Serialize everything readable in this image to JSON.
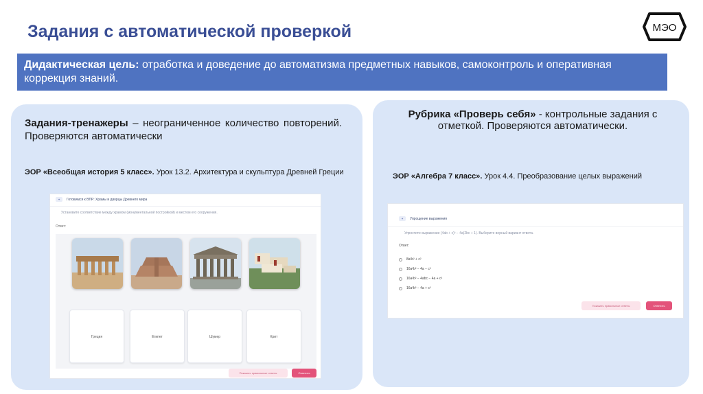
{
  "title": "Задания с автоматической проверкой",
  "logo_text": "МЭО",
  "goal": {
    "label": "Дидактическая цель:",
    "text": " отработка и доведение до автоматизма предметных навыков, самоконтроль и оперативная коррекция знаний."
  },
  "left": {
    "desc_bold": "Задания-тренажеры",
    "desc_text": " – неограниченное количество повторений. Проверяются автоматически",
    "eor_bold": "ЭОР «Всеобщая история 5 класс».",
    "eor_text": " Урок 13.2. Архитектура и скульптура Древней Греции",
    "screenshot": {
      "header": "Готовимся к ВПР: Храмы и дворцы Древнего мира",
      "instruction": "Установите соответствие между храмом (монументальной постройкой) и местом его сооружения.",
      "answer_label": "Ответ:",
      "cards": [
        "Греция",
        "Египет",
        "Шумер",
        "Крит"
      ],
      "show_answers_button": "Показать правильные ответы",
      "submit_button": "Ответить"
    }
  },
  "right": {
    "desc_bold": "Рубрика «Проверь себя»",
    "desc_text": " - контрольные задания с отметкой. Проверяются автоматически.",
    "eor_bold": "ЭОР «Алгебра 7 класс».",
    "eor_text": " Урок 4.4. Преобразование целых выражений",
    "screenshot": {
      "header": "Упрощение выражения",
      "task": "Упростите выражение (4ab + c)² − 4a(2bc + 1). Выберите верный вариант ответа.",
      "answer_label": "Ответ:",
      "options": [
        "8a²b² + c²",
        "16a²b² − 4a − c²",
        "16a²b² − 4abc − 4a + c²",
        "16a²b² − 4a + c²"
      ],
      "show_answers_button": "Показать правильные ответы",
      "submit_button": "Ответить"
    }
  },
  "colors": {
    "title": "#3a4e95",
    "goal_bar": "#4f73c1",
    "panel": "#dae6f8",
    "submit": "#e3537a"
  }
}
